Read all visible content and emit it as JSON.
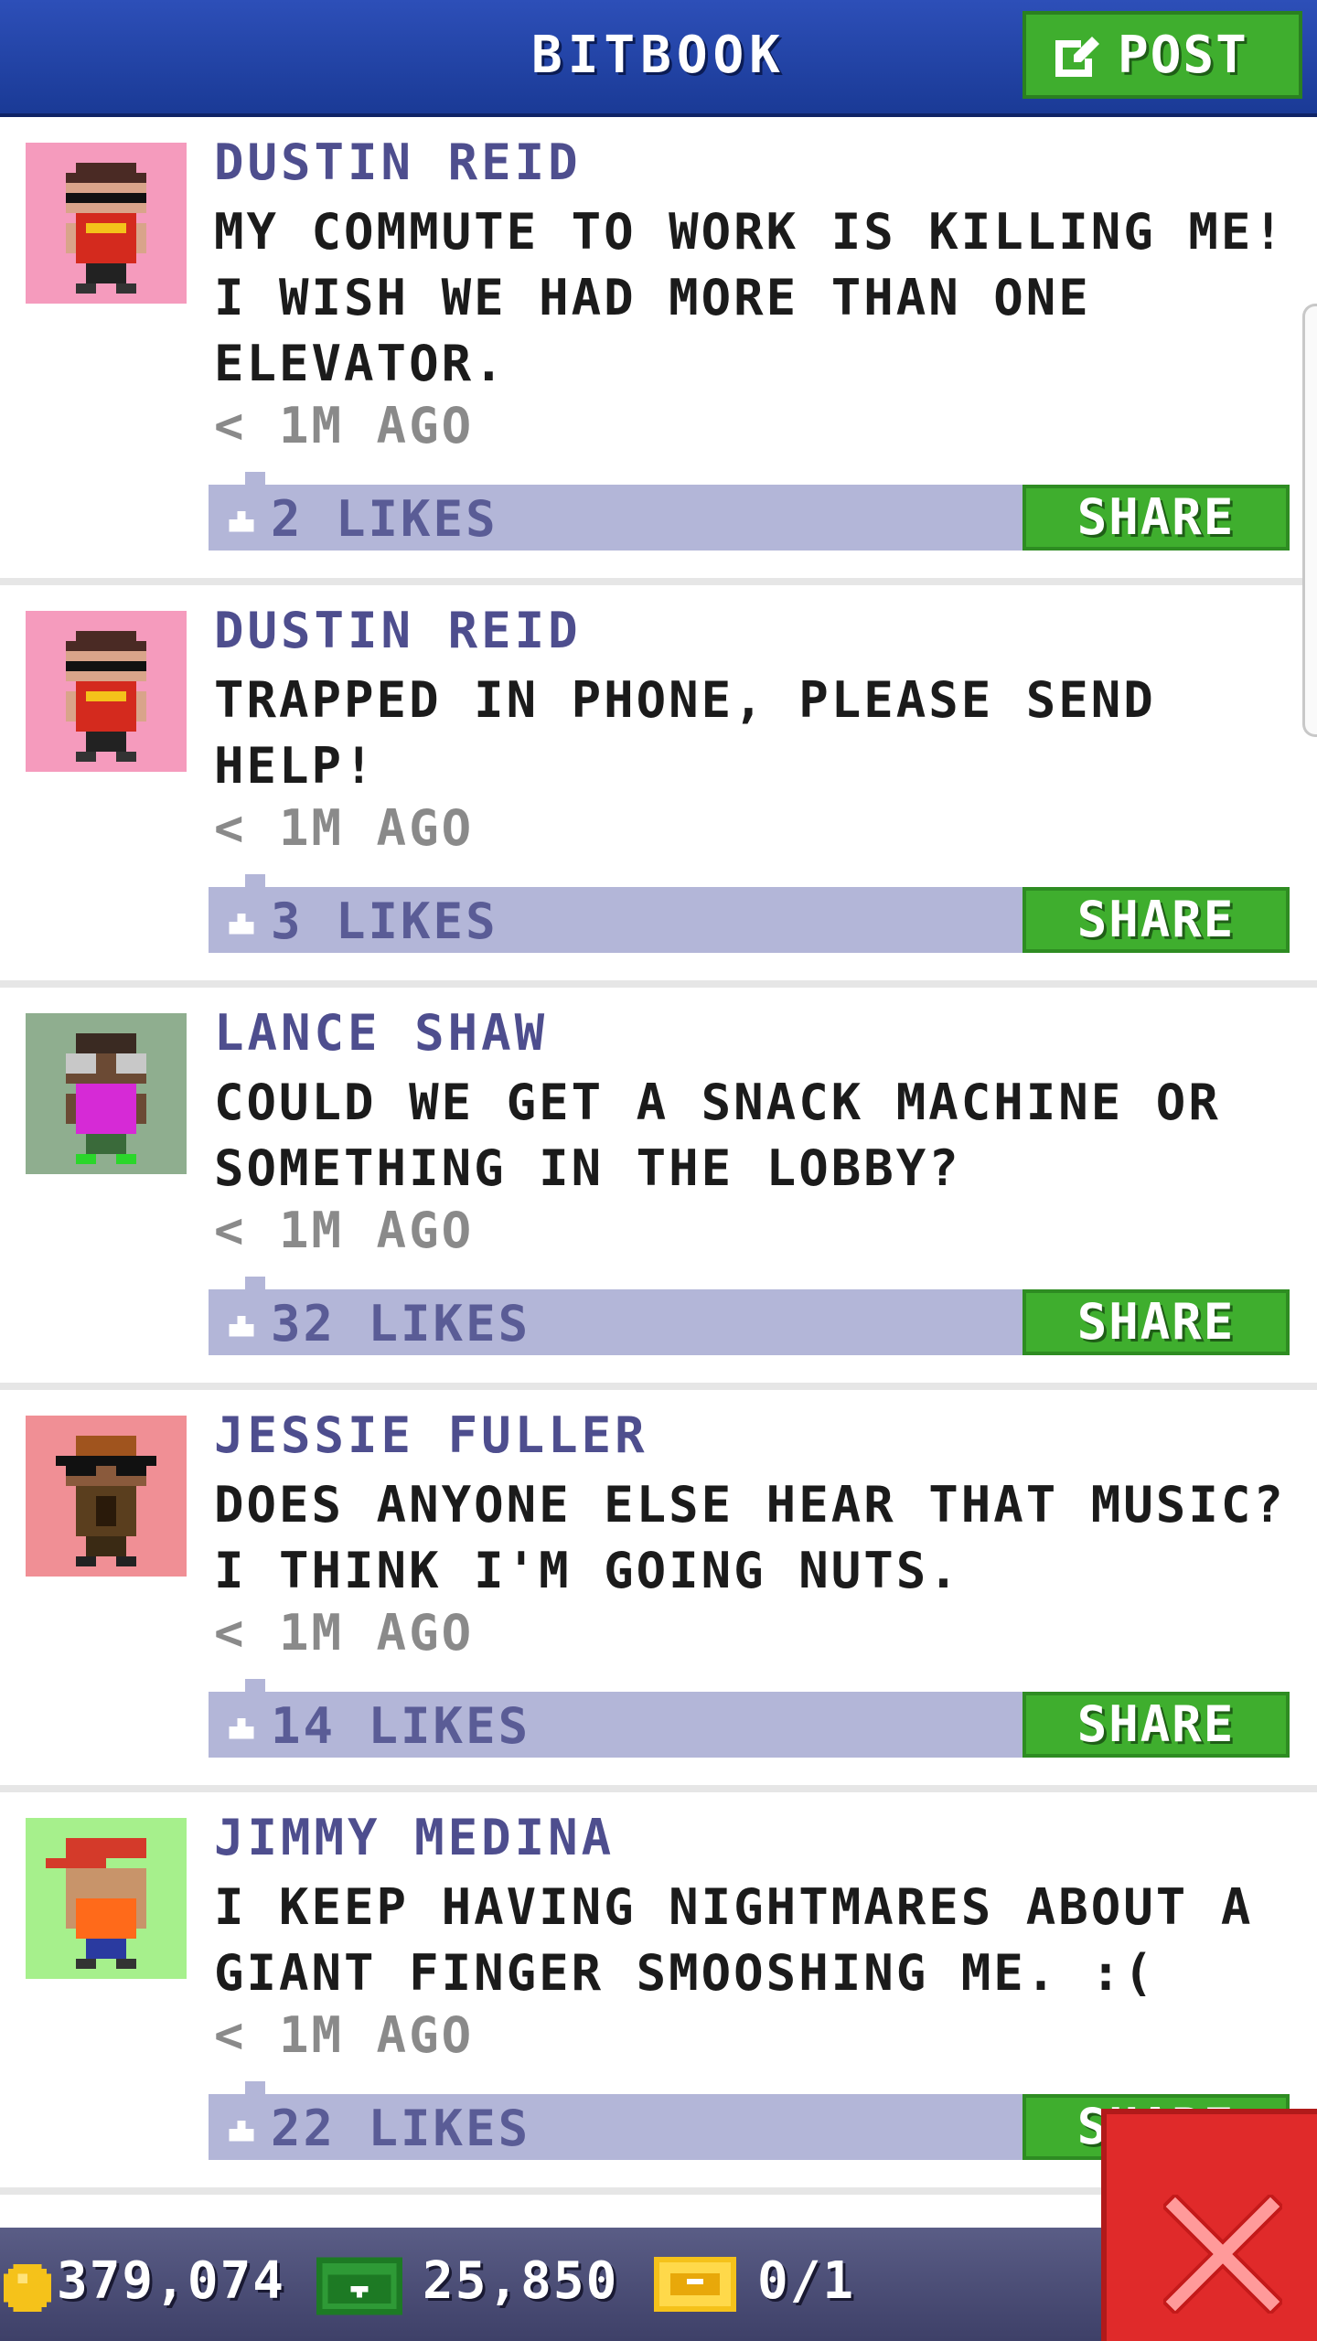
{
  "header": {
    "title": "BITBOOK",
    "post_label": "POST"
  },
  "posts": [
    {
      "author": "DUSTIN REID",
      "text": "MY COMMUTE TO WORK IS KILLING ME! I WISH WE HAD MORE THAN ONE ELEVATOR.",
      "time": "< 1M AGO",
      "likes": "2 LIKES",
      "share": "SHARE",
      "avatar_bg": "#f59bbd"
    },
    {
      "author": "DUSTIN REID",
      "text": "TRAPPED IN PHONE, PLEASE SEND HELP!",
      "time": "< 1M AGO",
      "likes": "3 LIKES",
      "share": "SHARE",
      "avatar_bg": "#f59bbd"
    },
    {
      "author": "LANCE SHAW",
      "text": "COULD WE GET A SNACK MACHINE OR SOMETHING IN THE LOBBY?",
      "time": "< 1M AGO",
      "likes": "32 LIKES",
      "share": "SHARE",
      "avatar_bg": "#8fae8f"
    },
    {
      "author": "JESSIE FULLER",
      "text": "DOES ANYONE ELSE HEAR THAT MUSIC? I THINK I'M GOING NUTS.",
      "time": "< 1M AGO",
      "likes": "14 LIKES",
      "share": "SHARE",
      "avatar_bg": "#f08f95"
    },
    {
      "author": "JIMMY MEDINA",
      "text": "I KEEP HAVING NIGHTMARES ABOUT A GIANT FINGER SMOOSHING ME. :(",
      "time": "< 1M AGO",
      "likes": "22 LIKES",
      "share": "SHARE",
      "avatar_bg": "#a6f08c"
    }
  ],
  "status": {
    "coins": "379,074",
    "bux": "25,850",
    "tickets": "0/1"
  },
  "colors": {
    "header": "#1f44a8",
    "share_green": "#3fae2e",
    "like_bar": "#b3b6d8",
    "close_red": "#e02a2a"
  }
}
